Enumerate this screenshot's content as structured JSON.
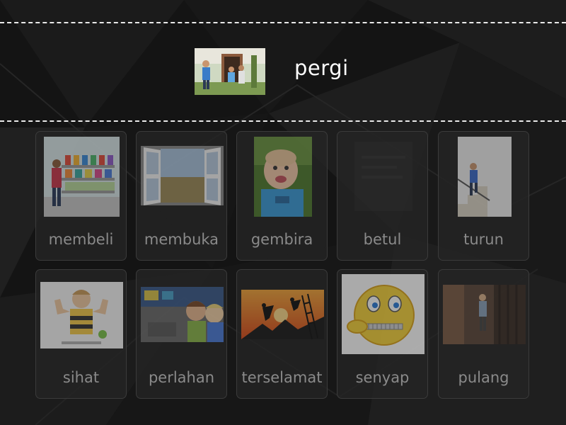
{
  "prompt": {
    "word": "pergi",
    "image_icon": "family-leaving-house-photo"
  },
  "cards": [
    {
      "label": "membeli",
      "icon": "shop-shelves-image"
    },
    {
      "label": "membuka",
      "icon": "open-window-image"
    },
    {
      "label": "gembira",
      "icon": "happy-baby-image"
    },
    {
      "label": "betul",
      "icon": "blank-card-image"
    },
    {
      "label": "turun",
      "icon": "boy-descending-stairs-image"
    },
    {
      "label": "sihat",
      "icon": "strong-boy-image"
    },
    {
      "label": "perlahan",
      "icon": "children-whispering-image"
    },
    {
      "label": "terselamat",
      "icon": "rescue-climb-silhouette-image"
    },
    {
      "label": "senyap",
      "icon": "zipped-mouth-emoji-image"
    },
    {
      "label": "pulang",
      "icon": "child-at-door-image"
    }
  ],
  "colors": {
    "background": "#141414",
    "card_border": "#3b3b3b",
    "label": "#8a8a8a",
    "prompt_text": "#ffffff"
  }
}
